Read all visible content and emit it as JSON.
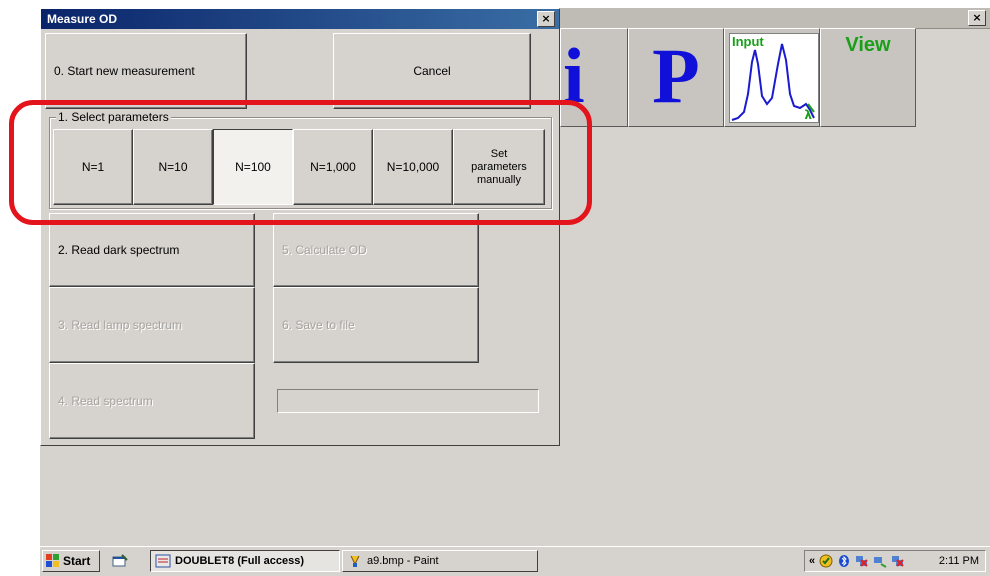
{
  "dialog": {
    "title": "Measure OD",
    "close_glyph": "×",
    "start_new_label": "0. Start new measurement",
    "cancel_label": "Cancel",
    "params_group_label": "1. Select parameters",
    "params": [
      {
        "label": "N=1",
        "selected": false
      },
      {
        "label": "N=10",
        "selected": false
      },
      {
        "label": "N=100",
        "selected": true
      },
      {
        "label": "N=1,000",
        "selected": false
      },
      {
        "label": "N=10,000",
        "selected": false
      },
      {
        "label": "Set\nparameters\nmanually",
        "selected": false
      }
    ],
    "steps": {
      "read_dark": {
        "label": "2. Read dark spectrum",
        "enabled": true
      },
      "read_lamp": {
        "label": "3. Read lamp spectrum",
        "enabled": false
      },
      "read_spectrum": {
        "label": "4. Read spectrum",
        "enabled": false
      },
      "calculate_od": {
        "label": "5. Calculate OD",
        "enabled": false
      },
      "save_to_file": {
        "label": "6. Save to file",
        "enabled": false
      }
    },
    "progress": 0
  },
  "background_app": {
    "close_glyph": "×",
    "tools": [
      {
        "label": "i",
        "icon": "info-letter"
      },
      {
        "label": "P",
        "icon": "parameters-letter"
      },
      {
        "label": "Input",
        "icon": "spectrum-graph",
        "axis_symbol": "λ"
      },
      {
        "label": "View",
        "icon": "view"
      }
    ]
  },
  "taskbar": {
    "start_label": "Start",
    "tasks": [
      {
        "label": "DOUBLET8 (Full access)",
        "active": true,
        "icon": "network-app-icon"
      },
      {
        "label": "a9.bmp - Paint",
        "active": false,
        "icon": "paint-icon"
      }
    ],
    "tray_chevron": "«",
    "clock": "2:11 PM"
  },
  "colors": {
    "highlight": "#e3141c",
    "title_bar": "#0a246a",
    "tool_letter": "#1010d8",
    "tool_label": "#18a018",
    "graph_line": "#1a1ad0"
  }
}
